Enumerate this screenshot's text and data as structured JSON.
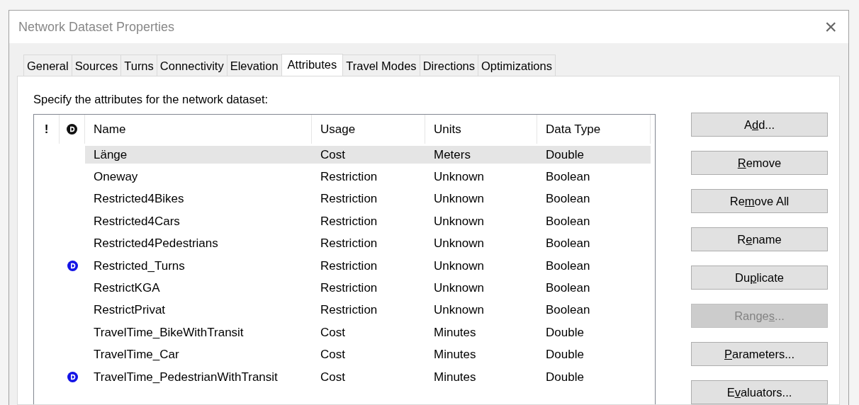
{
  "window": {
    "title": "Network Dataset Properties",
    "close": "×"
  },
  "tabs": [
    {
      "label": "General",
      "selected": false
    },
    {
      "label": "Sources",
      "selected": false
    },
    {
      "label": "Turns",
      "selected": false
    },
    {
      "label": "Connectivity",
      "selected": false
    },
    {
      "label": "Elevation",
      "selected": false
    },
    {
      "label": "Attributes",
      "selected": true
    },
    {
      "label": "Travel Modes",
      "selected": false
    },
    {
      "label": "Directions",
      "selected": false
    },
    {
      "label": "Optimizations",
      "selected": false
    }
  ],
  "instruction": "Specify the attributes for the network dataset:",
  "table": {
    "error_column": "!",
    "columns": [
      "Name",
      "Usage",
      "Units",
      "Data Type"
    ],
    "rows": [
      {
        "cells": [
          "Länge",
          "Cost",
          "Meters",
          "Double"
        ],
        "default": false,
        "selected": true
      },
      {
        "cells": [
          "Oneway",
          "Restriction",
          "Unknown",
          "Boolean"
        ],
        "default": false,
        "selected": false
      },
      {
        "cells": [
          "Restricted4Bikes",
          "Restriction",
          "Unknown",
          "Boolean"
        ],
        "default": false,
        "selected": false
      },
      {
        "cells": [
          "Restricted4Cars",
          "Restriction",
          "Unknown",
          "Boolean"
        ],
        "default": false,
        "selected": false
      },
      {
        "cells": [
          "Restricted4Pedestrians",
          "Restriction",
          "Unknown",
          "Boolean"
        ],
        "default": false,
        "selected": false
      },
      {
        "cells": [
          "Restricted_Turns",
          "Restriction",
          "Unknown",
          "Boolean"
        ],
        "default": true,
        "selected": false
      },
      {
        "cells": [
          "RestrictKGA",
          "Restriction",
          "Unknown",
          "Boolean"
        ],
        "default": false,
        "selected": false
      },
      {
        "cells": [
          "RestrictPrivat",
          "Restriction",
          "Unknown",
          "Boolean"
        ],
        "default": false,
        "selected": false
      },
      {
        "cells": [
          "TravelTime_BikeWithTransit",
          "Cost",
          "Minutes",
          "Double"
        ],
        "default": false,
        "selected": false
      },
      {
        "cells": [
          "TravelTime_Car",
          "Cost",
          "Minutes",
          "Double"
        ],
        "default": false,
        "selected": false
      },
      {
        "cells": [
          "TravelTime_PedestrianWithTransit",
          "Cost",
          "Minutes",
          "Double"
        ],
        "default": true,
        "selected": false
      }
    ]
  },
  "buttons": [
    {
      "before": "A",
      "mnemonic": "d",
      "after": "d...",
      "disabled": false
    },
    {
      "mnemonic": "R",
      "after": "emove",
      "disabled": false
    },
    {
      "before": "Re",
      "mnemonic": "m",
      "after": "ove All",
      "disabled": false
    },
    {
      "before": "R",
      "mnemonic": "e",
      "after": "name",
      "disabled": false
    },
    {
      "before": "Du",
      "mnemonic": "p",
      "after": "licate",
      "disabled": false
    },
    {
      "before": "Range",
      "mnemonic": "s",
      "after": "...",
      "disabled": true
    },
    {
      "mnemonic": "P",
      "after": "arameters...",
      "disabled": false
    },
    {
      "before": "E",
      "mnemonic": "v",
      "after": "aluators...",
      "disabled": false
    }
  ]
}
